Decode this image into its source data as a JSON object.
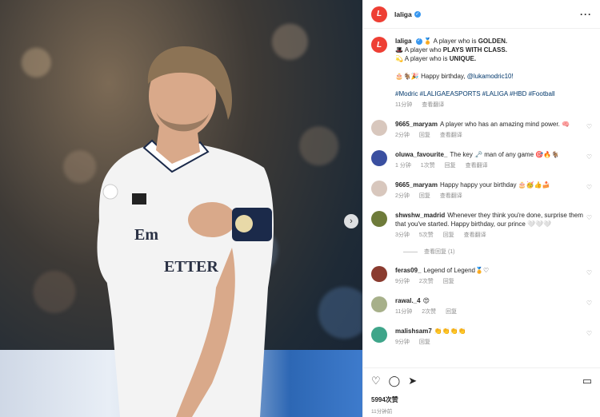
{
  "post": {
    "username": "laliga",
    "caption_lines": [
      "🏅 A player who is ",
      "🎩 A player who ",
      "💫 A player who is "
    ],
    "caption_bold": [
      "GOLDEN.",
      "PLAYS WITH CLASS.",
      "UNIQUE."
    ],
    "birthday_prefix": "🎂🐐🎉 Happy birthday, ",
    "birthday_mention": "@lukamodric10!",
    "hashtags": "#Modric #LALIGAEASPORTS #LALIGA #HBD #Football",
    "time": "11分钟",
    "translate": "查看翻译"
  },
  "comments": [
    {
      "user": "9665_maryam",
      "text": "A player who has an amazing mind power. 🧠",
      "time": "2分钟",
      "likes": "",
      "reply": "回复",
      "translate": "查看翻译",
      "avatar_color": "#d8c7bd"
    },
    {
      "user": "oluwa_favourite_",
      "text": "The key 🗝️ man of any game 🎯🔥🐐",
      "time": "1 分钟",
      "likes": "1次赞",
      "reply": "回复",
      "translate": "查看翻译",
      "avatar_color": "#3a4fa0"
    },
    {
      "user": "9665_maryam",
      "text": "Happy happy your birthday 🎂🥳👍🍰",
      "time": "2分钟",
      "likes": "",
      "reply": "回复",
      "translate": "查看翻译",
      "avatar_color": "#d8c7bd"
    },
    {
      "user": "shwshw_madrid",
      "text": "Whenever they think you're done, surprise them that you've started. Happy birthday, our prince 🤍🤍🤍",
      "time": "3分钟",
      "likes": "5次赞",
      "reply": "回复",
      "translate": "查看翻译",
      "avatar_color": "#6e7b3a"
    },
    {
      "user": "feras09_",
      "text": "Legend of Legend🏅♡",
      "time": "9分钟",
      "likes": "2次赞",
      "reply": "回复",
      "translate": "",
      "avatar_color": "#8a3b2f"
    },
    {
      "user": "rawal._4",
      "text": "😍",
      "time": "11分钟",
      "likes": "2次赞",
      "reply": "回复",
      "translate": "",
      "avatar_color": "#a7b08a"
    },
    {
      "user": "malishsam7",
      "text": "👏👏👏👏",
      "time": "9分钟",
      "likes": "",
      "reply": "回复",
      "translate": "",
      "avatar_color": "#3fa58a"
    }
  ],
  "view_replies": "查看回复 (1)",
  "footer": {
    "likes": "5994次赞",
    "time": "11分钟前"
  },
  "colors": {
    "brand": "#ee3f34",
    "verified": "#3897f0",
    "link": "#00376b"
  },
  "icons": [
    "more-icon",
    "heart-icon",
    "comment-icon",
    "share-icon",
    "bookmark-icon",
    "chevron-right-icon"
  ]
}
